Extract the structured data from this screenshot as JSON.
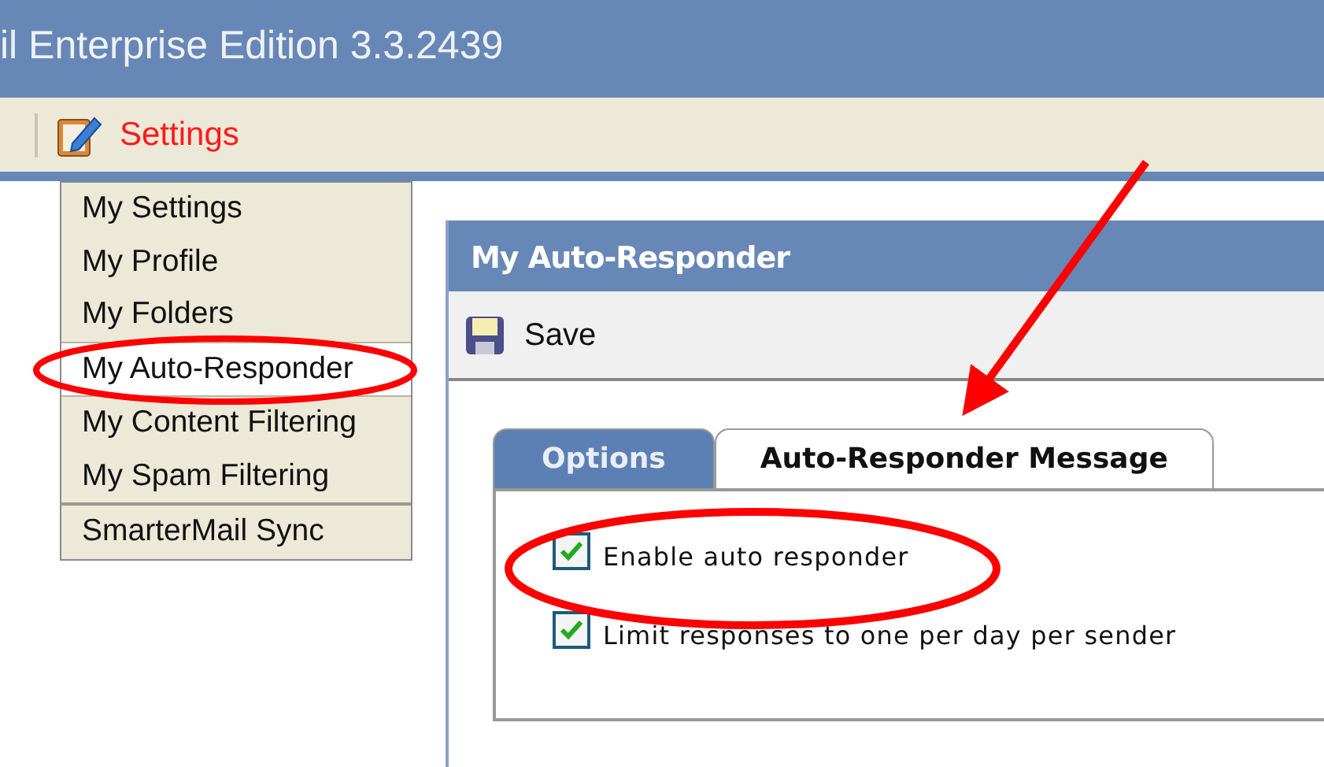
{
  "window": {
    "title": "il Enterprise Edition 3.3.2439"
  },
  "toolbar": {
    "settings_label": "Settings"
  },
  "settings_menu": {
    "items": [
      {
        "label": "My Settings",
        "selected": false
      },
      {
        "label": "My Profile",
        "selected": false
      },
      {
        "label": "My Folders",
        "selected": false
      },
      {
        "label": "My Auto-Responder",
        "selected": true
      },
      {
        "label": "My Content Filtering",
        "selected": false
      },
      {
        "label": "My Spam Filtering",
        "selected": false
      },
      {
        "label": "SmarterMail Sync",
        "selected": false,
        "separator_before": true
      }
    ]
  },
  "panel": {
    "title": "My Auto-Responder",
    "save_label": "Save",
    "tabs": [
      {
        "label": "Options",
        "selected": true
      },
      {
        "label": "Auto-Responder Message",
        "selected": false
      }
    ],
    "options": [
      {
        "label": "Enable auto responder",
        "checked": true
      },
      {
        "label": "Limit responses to one per day per sender",
        "checked": true
      }
    ]
  }
}
